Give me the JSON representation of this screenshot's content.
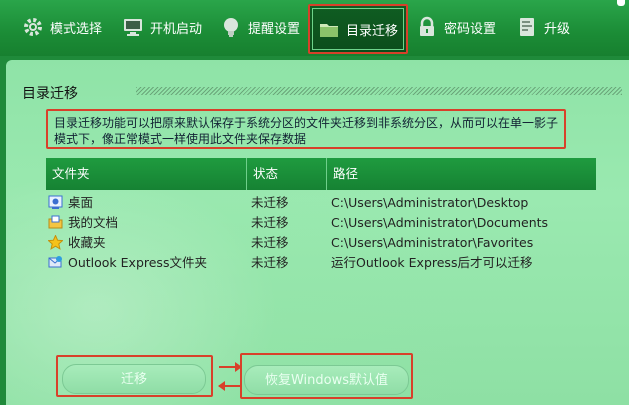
{
  "toolbar": {
    "tabs": [
      {
        "label": "模式选择",
        "icon": "gear-icon"
      },
      {
        "label": "开机启动",
        "icon": "monitor-icon"
      },
      {
        "label": "提醒设置",
        "icon": "lightbulb-icon"
      },
      {
        "label": "目录迁移",
        "icon": "folder-icon",
        "active": true
      },
      {
        "label": "密码设置",
        "icon": "lock-icon"
      },
      {
        "label": "升级",
        "icon": "upgrade-icon"
      }
    ]
  },
  "section": {
    "title": "目录迁移",
    "description": "目录迁移功能可以把原来默认保存于系统分区的文件夹迁移到非系统分区，从而可以在单一影子模式下，像正常模式一样使用此文件夹保存数据"
  },
  "table": {
    "headers": [
      "文件夹",
      "状态",
      "路径"
    ],
    "rows": [
      {
        "folder": "桌面",
        "status": "未迁移",
        "path": "C:\\Users\\Administrator\\Desktop",
        "icon": "desktop-icon"
      },
      {
        "folder": "我的文档",
        "status": "未迁移",
        "path": "C:\\Users\\Administrator\\Documents",
        "icon": "documents-icon"
      },
      {
        "folder": "收藏夹",
        "status": "未迁移",
        "path": "C:\\Users\\Administrator\\Favorites",
        "icon": "star-icon"
      },
      {
        "folder": "Outlook Express文件夹",
        "status": "未迁移",
        "path": "运行Outlook Express后才可以迁移",
        "icon": "outlook-icon"
      }
    ]
  },
  "buttons": {
    "migrate": "迁移",
    "restore": "恢复Windows默认值"
  },
  "colors": {
    "toolbar": "#1b8c36",
    "panel": "#9ae9b0",
    "highlight": "#d8402a",
    "table_header": "#1f9b3f"
  }
}
